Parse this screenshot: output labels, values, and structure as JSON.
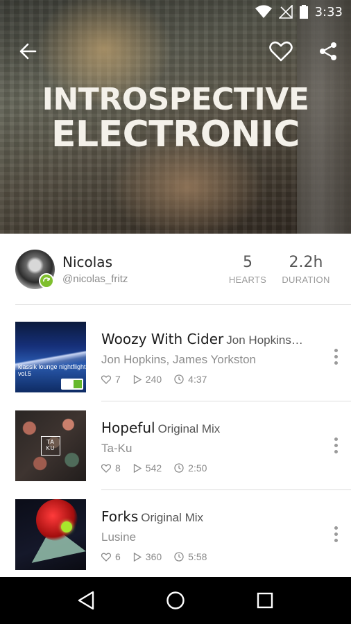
{
  "status_bar": {
    "time": "3:33"
  },
  "hero": {
    "title_line1": "INTROSPECTIVE",
    "title_line2": "ELECTRONIC"
  },
  "profile": {
    "name": "Nicolas",
    "handle": "@nicolas_fritz",
    "stats": [
      {
        "value": "5",
        "label": "HEARTS"
      },
      {
        "value": "2.2h",
        "label": "DURATION"
      }
    ]
  },
  "tracks": [
    {
      "title": "Woozy With Cider",
      "subtitle": "Jon Hopkins…",
      "artist": "Jon Hopkins, James Yorkston",
      "hearts": "7",
      "plays": "240",
      "duration": "4:37",
      "cover_text": "klassik lounge nightflight vol.5"
    },
    {
      "title": "Hopeful",
      "subtitle": "Original Mix",
      "artist": "Ta-Ku",
      "hearts": "8",
      "plays": "542",
      "duration": "2:50",
      "cover_text": "TA KU"
    },
    {
      "title": "Forks",
      "subtitle": "Original Mix",
      "artist": "Lusine",
      "hearts": "6",
      "plays": "360",
      "duration": "5:58"
    }
  ],
  "icons": {
    "back": "arrow-left-icon",
    "heart": "heart-outline-icon",
    "share": "share-icon",
    "nav_back": "triangle-back-icon",
    "nav_home": "circle-home-icon",
    "nav_recents": "square-recents-icon"
  },
  "colors": {
    "accent_green": "#7fbf2e",
    "nav_bar": "#000000"
  }
}
